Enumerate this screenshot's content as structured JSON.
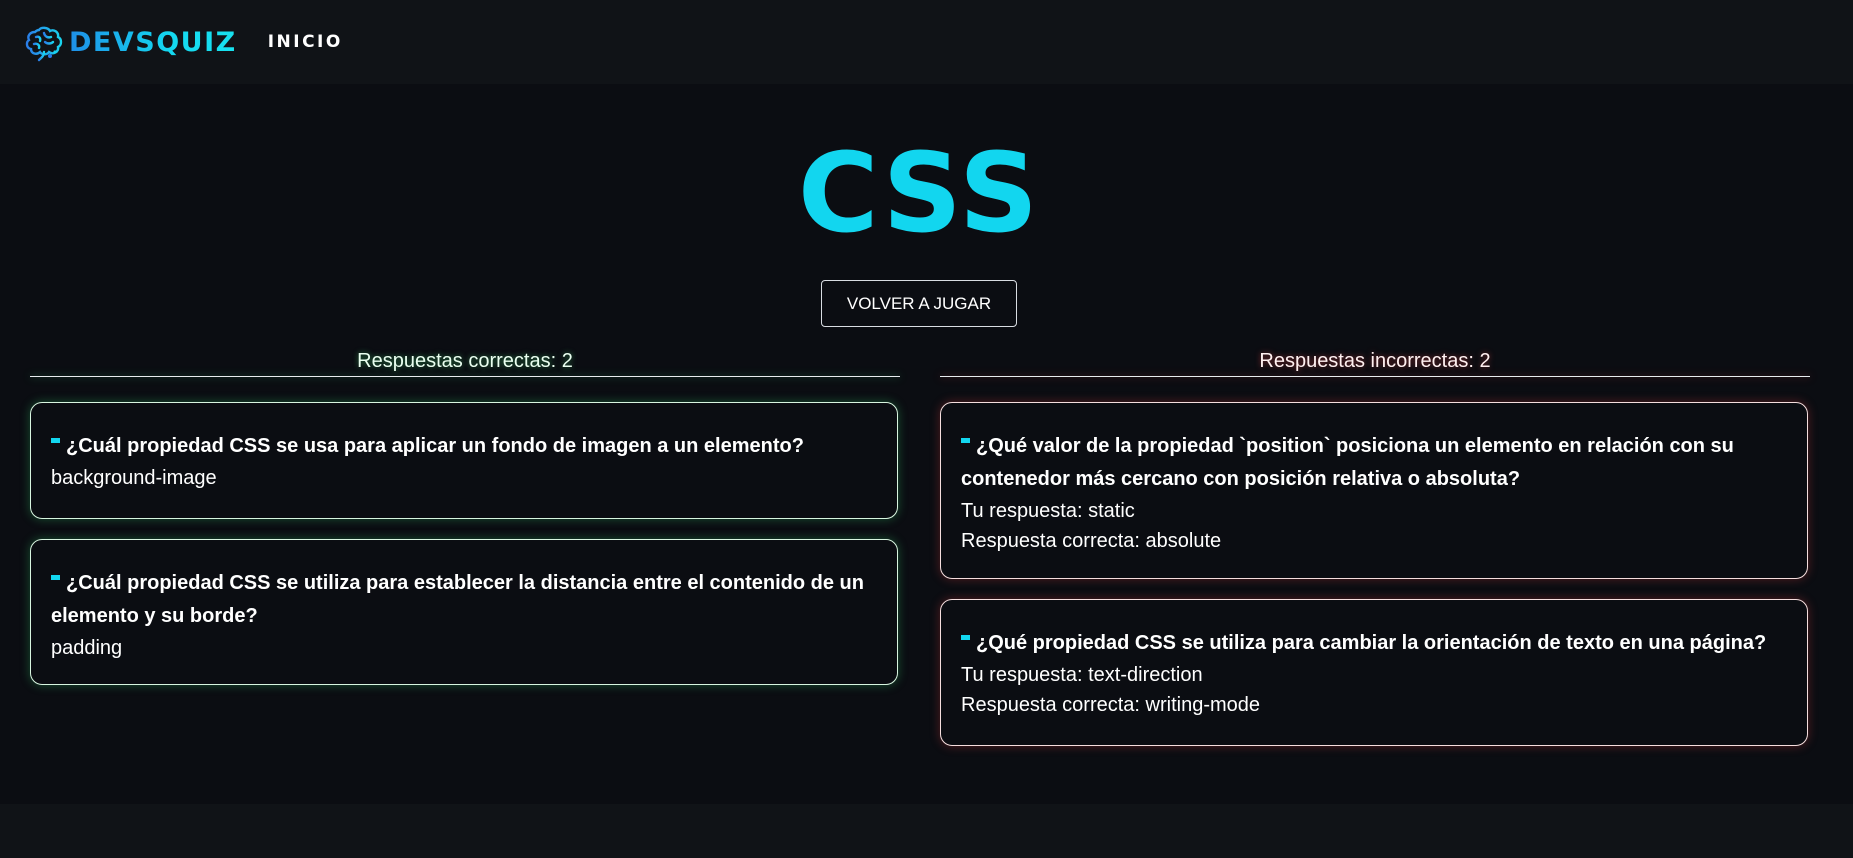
{
  "nav": {
    "brand": "DEVSQUIZ",
    "brand_icon": "brain-icon",
    "links": [
      "INICIO"
    ]
  },
  "page": {
    "title": "CSS",
    "replay_label": "VOLVER A JUGAR"
  },
  "correct": {
    "header": "Respuestas correctas: 2",
    "items": [
      {
        "question": "¿Cuál propiedad CSS se usa para aplicar un fondo de imagen a un elemento?",
        "answer": "background-image"
      },
      {
        "question": "¿Cuál propiedad CSS se utiliza para establecer la distancia entre el contenido de un elemento y su borde?",
        "answer": "padding"
      }
    ]
  },
  "incorrect": {
    "header": "Respuestas incorrectas: 2",
    "items": [
      {
        "question": "¿Qué valor de la propiedad `position` posiciona un elemento en relación con su contenedor más cercano con posición relativa o absoluta?",
        "your_answer": "Tu respuesta: static",
        "correct_answer": "Respuesta correcta: absolute"
      },
      {
        "question": "¿Qué propiedad CSS se utiliza para cambiar la orientación de texto en una página?",
        "your_answer": "Tu respuesta: text-direction",
        "correct_answer": "Respuesta correcta: writing-mode"
      }
    ]
  },
  "colors": {
    "accent": "#12d6ef",
    "background": "#0b0d12",
    "navbar": "#101317",
    "correct_glow": "#3cdc78",
    "incorrect_glow": "#e63c3c"
  }
}
